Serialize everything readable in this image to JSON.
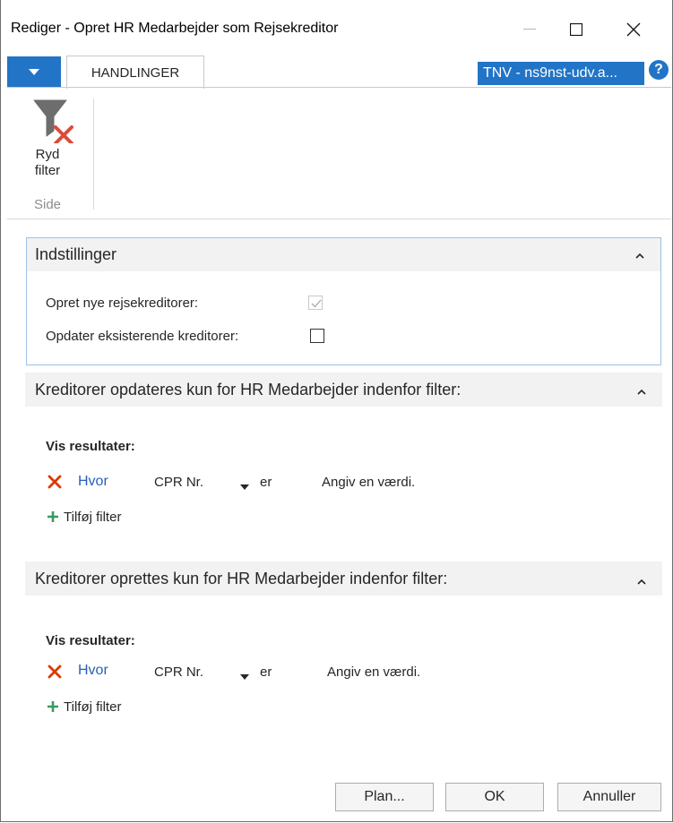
{
  "window": {
    "title": "Rediger - Opret HR Medarbejder som Rejsekreditor"
  },
  "ribbon": {
    "tab_label": "HANDLINGER",
    "company_badge": "TNV - ns9nst-udv.a...",
    "help_symbol": "?",
    "action_label_line1": "Ryd",
    "action_label_line2": "filter",
    "group_label": "Side",
    "action_icon": "clear-filter-icon"
  },
  "settings": {
    "title": "Indstillinger",
    "fields": [
      {
        "label": "Opret nye rejsekreditorer:",
        "checked": true,
        "enabled": false
      },
      {
        "label": "Opdater eksisterende kreditorer:",
        "checked": false,
        "enabled": true
      }
    ]
  },
  "update_filter": {
    "title": "Kreditorer opdateres kun for HR Medarbejder indenfor filter:",
    "show_results": "Vis resultater:",
    "where": "Hvor",
    "field": "CPR Nr.",
    "operator": "er",
    "value_placeholder": "Angiv en værdi.",
    "add_filter": "Tilføj filter"
  },
  "create_filter": {
    "title": "Kreditorer oprettes kun for HR Medarbejder indenfor filter:",
    "show_results": "Vis resultater:",
    "where": "Hvor",
    "field": "CPR Nr.",
    "operator": "er",
    "value_placeholder": "Angiv en værdi.",
    "add_filter": "Tilføj filter"
  },
  "buttons": {
    "plan": "Plan...",
    "ok": "OK",
    "cancel": "Annuller"
  },
  "colors": {
    "accent": "#2274c6",
    "link": "#2860b8",
    "remove": "#d83b01",
    "add": "#3a9a62"
  }
}
